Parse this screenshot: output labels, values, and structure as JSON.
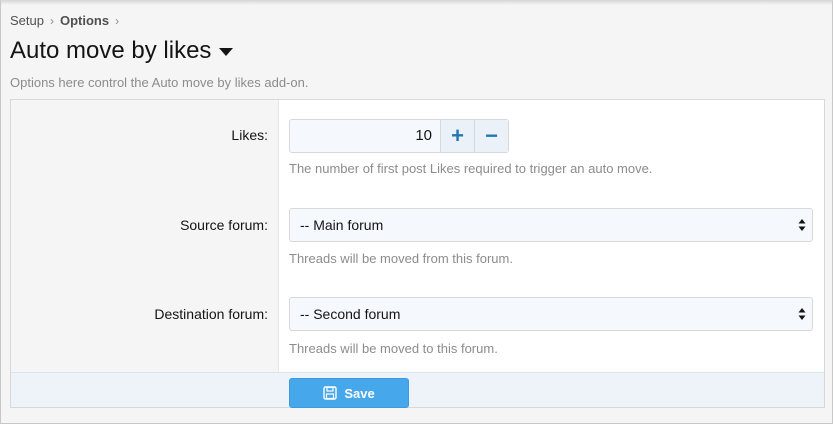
{
  "breadcrumb": [
    {
      "label": "Setup"
    },
    {
      "label": "Options"
    }
  ],
  "page": {
    "title": "Auto move by likes",
    "description": "Options here control the Auto move by likes add-on."
  },
  "fields": {
    "likes": {
      "label": "Likes:",
      "value": "10",
      "hint": "The number of first post Likes required to trigger an auto move.",
      "increment_icon": "plus-icon",
      "decrement_icon": "minus-icon"
    },
    "source_forum": {
      "label": "Source forum:",
      "selected": "-- Main forum",
      "hint": "Threads will be moved from this forum."
    },
    "destination_forum": {
      "label": "Destination forum:",
      "selected": "-- Second forum",
      "hint": "Threads will be moved to this forum."
    }
  },
  "footer": {
    "save_label": "Save",
    "save_icon": "floppy-disk-icon"
  },
  "colors": {
    "accent": "#47a7eb",
    "stepper": "#2577b1",
    "muted_text": "#8c8c8c"
  }
}
